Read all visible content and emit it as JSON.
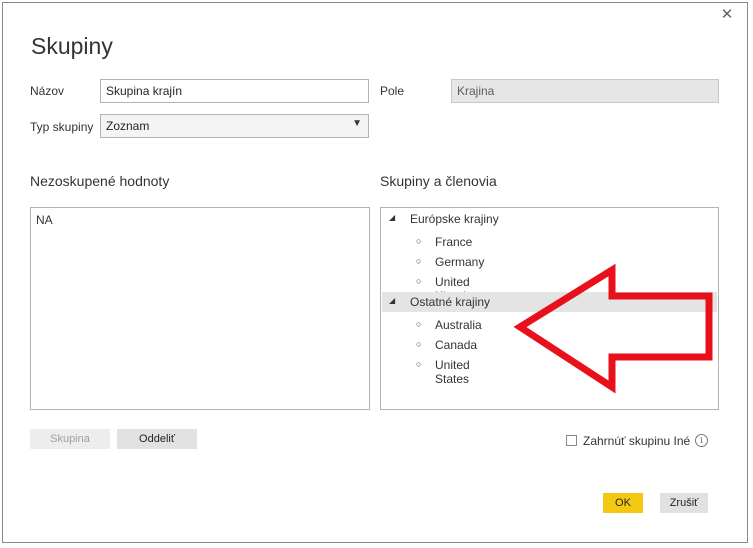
{
  "dialog": {
    "title": "Skupiny",
    "close_icon": "close-icon"
  },
  "form": {
    "name_label": "Názov",
    "name_value": "Skupina krajín",
    "field_label": "Pole",
    "field_value": "Krajina",
    "type_label": "Typ skupiny",
    "type_value": "Zoznam"
  },
  "ungrouped": {
    "heading": "Nezoskupené hodnoty",
    "items": [
      "NA"
    ]
  },
  "groups": {
    "heading": "Skupiny a členovia",
    "tree": [
      {
        "name": "Európske krajiny",
        "members": [
          "France",
          "Germany",
          "United Kingdom"
        ]
      },
      {
        "name": "Ostatné krajiny",
        "members": [
          "Australia",
          "Canada",
          "United States"
        ],
        "selected": true
      }
    ]
  },
  "buttons": {
    "group_label": "Skupina",
    "ungroup_label": "Oddeliť",
    "ok_label": "OK",
    "cancel_label": "Zrušiť"
  },
  "include_other": {
    "label": "Zahrnúť skupinu Iné",
    "checked": false
  },
  "colors": {
    "accent": "#F2C811",
    "annotation_arrow": "#E8101B"
  }
}
